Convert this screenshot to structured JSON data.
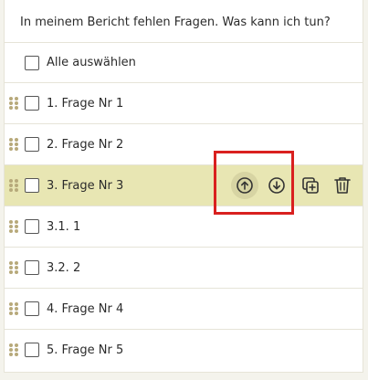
{
  "header": {
    "question": "In meinem Bericht fehlen Fragen. Was kann ich tun?"
  },
  "select_all": {
    "label": "Alle auswählen"
  },
  "items": [
    {
      "label": "1.  Frage Nr 1",
      "selected": false
    },
    {
      "label": "2.  Frage Nr 2",
      "selected": false
    },
    {
      "label": "3.  Frage Nr 3",
      "selected": true
    },
    {
      "label": "3.1.  1",
      "selected": false
    },
    {
      "label": "3.2.  2",
      "selected": false
    },
    {
      "label": "4.  Frage Nr 4",
      "selected": false
    },
    {
      "label": "5.  Frage Nr 5",
      "selected": false
    }
  ],
  "icons": {
    "move_up": "arrow-up-circle-icon",
    "move_down": "arrow-down-circle-icon",
    "duplicate": "duplicate-icon",
    "delete": "trash-icon",
    "drag": "drag-handle-icon"
  },
  "colors": {
    "selected_row": "#e8e6b3",
    "highlight": "#d9201f",
    "drag_handle": "#b7a97a"
  }
}
